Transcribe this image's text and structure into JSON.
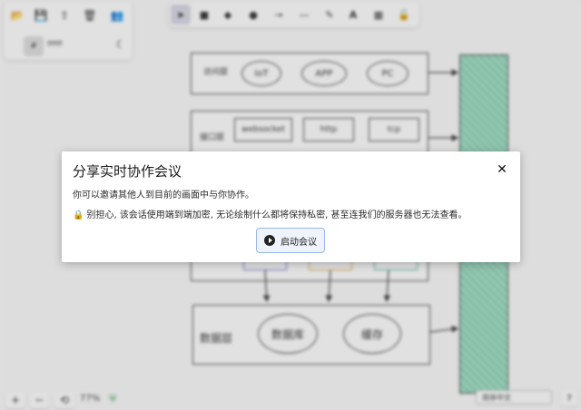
{
  "toolbar_left": {
    "icons": [
      "open-icon",
      "save-icon",
      "export-icon",
      "trash-icon",
      "collaborate-icon"
    ],
    "hash_label": "#",
    "color_value": "ffffff"
  },
  "tools": [
    "selection-tool-icon",
    "rectangle-tool-icon",
    "diamond-tool-icon",
    "ellipse-tool-icon",
    "arrow-tool-icon",
    "line-tool-icon",
    "draw-tool-icon",
    "text-tool-icon",
    "library-tool-icon",
    "lock-tool-icon"
  ],
  "diagram": {
    "access_layer": "访问层",
    "clients": [
      "IoT",
      "APP",
      "PC"
    ],
    "interface_layer": "接口层",
    "protocols": [
      "websocket",
      "http",
      "tcp"
    ],
    "data_layer": "数据层",
    "stores": [
      "数据库",
      "缓存"
    ]
  },
  "bottom": {
    "zoom": "77%",
    "language": "简体中文",
    "help": "?"
  },
  "dialog": {
    "title": "分享实时协作会议",
    "line1": "你可以邀请其他人到目前的画面中与你协作。",
    "line2": "别担心, 该会话使用端到端加密, 无论绘制什么都将保持私密, 甚至连我们的服务器也无法查看。",
    "start_label": "启动会议",
    "close": "✕"
  }
}
